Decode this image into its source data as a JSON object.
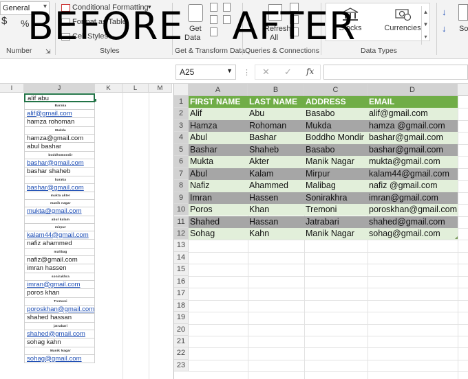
{
  "ribbon": {
    "number_format": "General",
    "currency_symbol": "$",
    "percent_symbol": "%",
    "conditional_formatting": "Conditional Formatting",
    "format_as_table": "Format as Table",
    "cell_styles": "Cell Styles",
    "get_data": "Get",
    "get_data_2": "Data",
    "refresh_all": "Refresh",
    "refresh_all_2": "All",
    "stocks": "Stocks",
    "currencies": "Currencies",
    "sort_label": "So",
    "groups": {
      "number": "Number",
      "styles": "Styles",
      "get_transform": "Get & Transform Data",
      "queries": "Queries & Connections",
      "data_types": "Data Types"
    }
  },
  "overlay": {
    "before": "BEFORE",
    "after": "AFTER"
  },
  "formula_bar": {
    "name_box": "A25",
    "fx": "fx"
  },
  "left_sheet": {
    "columns": [
      "I",
      "J",
      "K",
      "L",
      "M"
    ],
    "rows": [
      {
        "text": "alif abu",
        "style": "sel"
      },
      {
        "text": "Baraka",
        "style": "mini"
      },
      {
        "text": "alif@gmail.com",
        "style": "link"
      },
      {
        "text": "hamza rohoman",
        "style": "normal"
      },
      {
        "text": "Mukda",
        "style": "mini"
      },
      {
        "text": "hamza@gmail.com",
        "style": "normal"
      },
      {
        "text": "abul bashar",
        "style": "normal"
      },
      {
        "text": "boddhomondir",
        "style": "mini"
      },
      {
        "text": "bashar@gmail.com",
        "style": "link"
      },
      {
        "text": "bashar shaheb",
        "style": "normal"
      },
      {
        "text": "baraka",
        "style": "mini"
      },
      {
        "text": "bashar@gmail.com",
        "style": "link"
      },
      {
        "text": "mukta akter",
        "style": "mini"
      },
      {
        "text": "manik nagar",
        "style": "mini"
      },
      {
        "text": "mukta@gmail.com",
        "style": "link"
      },
      {
        "text": "abul kalam",
        "style": "mini"
      },
      {
        "text": "mirpur",
        "style": "mini"
      },
      {
        "text": "kalam44@gmail.com",
        "style": "link"
      },
      {
        "text": "nafiz ahammed",
        "style": "normal"
      },
      {
        "text": "malibag",
        "style": "mini"
      },
      {
        "text": "nafiz@gmail.com",
        "style": "normal"
      },
      {
        "text": "imran hassen",
        "style": "normal"
      },
      {
        "text": "sonirakhra",
        "style": "mini"
      },
      {
        "text": "imran@gmail.com",
        "style": "link"
      },
      {
        "text": "poros khan",
        "style": "normal"
      },
      {
        "text": "Tremoni",
        "style": "mini"
      },
      {
        "text": "poroskhan@gmail.com",
        "style": "link"
      },
      {
        "text": "shahed hassan",
        "style": "normal"
      },
      {
        "text": "jatrabari",
        "style": "mini"
      },
      {
        "text": "shahed@gmail.com",
        "style": "link"
      },
      {
        "text": "sohag kahn",
        "style": "normal"
      },
      {
        "text": "Manik Nagar",
        "style": "mini"
      },
      {
        "text": "sohag@gmail.com",
        "style": "link"
      }
    ]
  },
  "right_sheet": {
    "columns": [
      "A",
      "B",
      "C",
      "D"
    ],
    "row_numbers": [
      "1",
      "2",
      "3",
      "4",
      "5",
      "6",
      "7",
      "8",
      "9",
      "10",
      "11",
      "12",
      "13",
      "14",
      "15",
      "16",
      "17",
      "18",
      "19",
      "20",
      "21",
      "22",
      "23"
    ],
    "header": [
      "FIRST NAME",
      "LAST NAME",
      "ADDRESS",
      "EMAIL"
    ],
    "rows": [
      [
        "Alif",
        "Abu",
        "Basabo",
        "alif@gmail.com"
      ],
      [
        "Hamza",
        "Rohoman",
        "Mukda",
        "hamza @gmail.com"
      ],
      [
        "Abul",
        "Bashar",
        "Boddho Mondir",
        "bashar@gmail.com"
      ],
      [
        "Bashar",
        "Shaheb",
        "Basabo",
        "bashar@gmail.com"
      ],
      [
        "Mukta",
        "Akter",
        "Manik Nagar",
        "mukta@gmail.com"
      ],
      [
        "Abul",
        "Kalam",
        "Mirpur",
        "kalam44@gmail.com"
      ],
      [
        "Nafiz",
        "Ahammed",
        "Malibag",
        "nafiz @gmail.com"
      ],
      [
        "Imran",
        "Hassen",
        "Sonirakhra",
        "imran@gmail.com"
      ],
      [
        "Poros",
        "Khan",
        "Tremoni",
        "poroskhan@gmail.com"
      ],
      [
        "Shahed",
        "Hassan",
        "Jatrabari",
        "shahed@gmail.com"
      ],
      [
        "Sohag",
        "Kahn",
        "Manik Nagar",
        "sohag@gmail.com"
      ]
    ],
    "colors": {
      "header_bg": "#70ad47",
      "band_light": "#e2efda",
      "band_dark": "#a6a6a6"
    }
  }
}
